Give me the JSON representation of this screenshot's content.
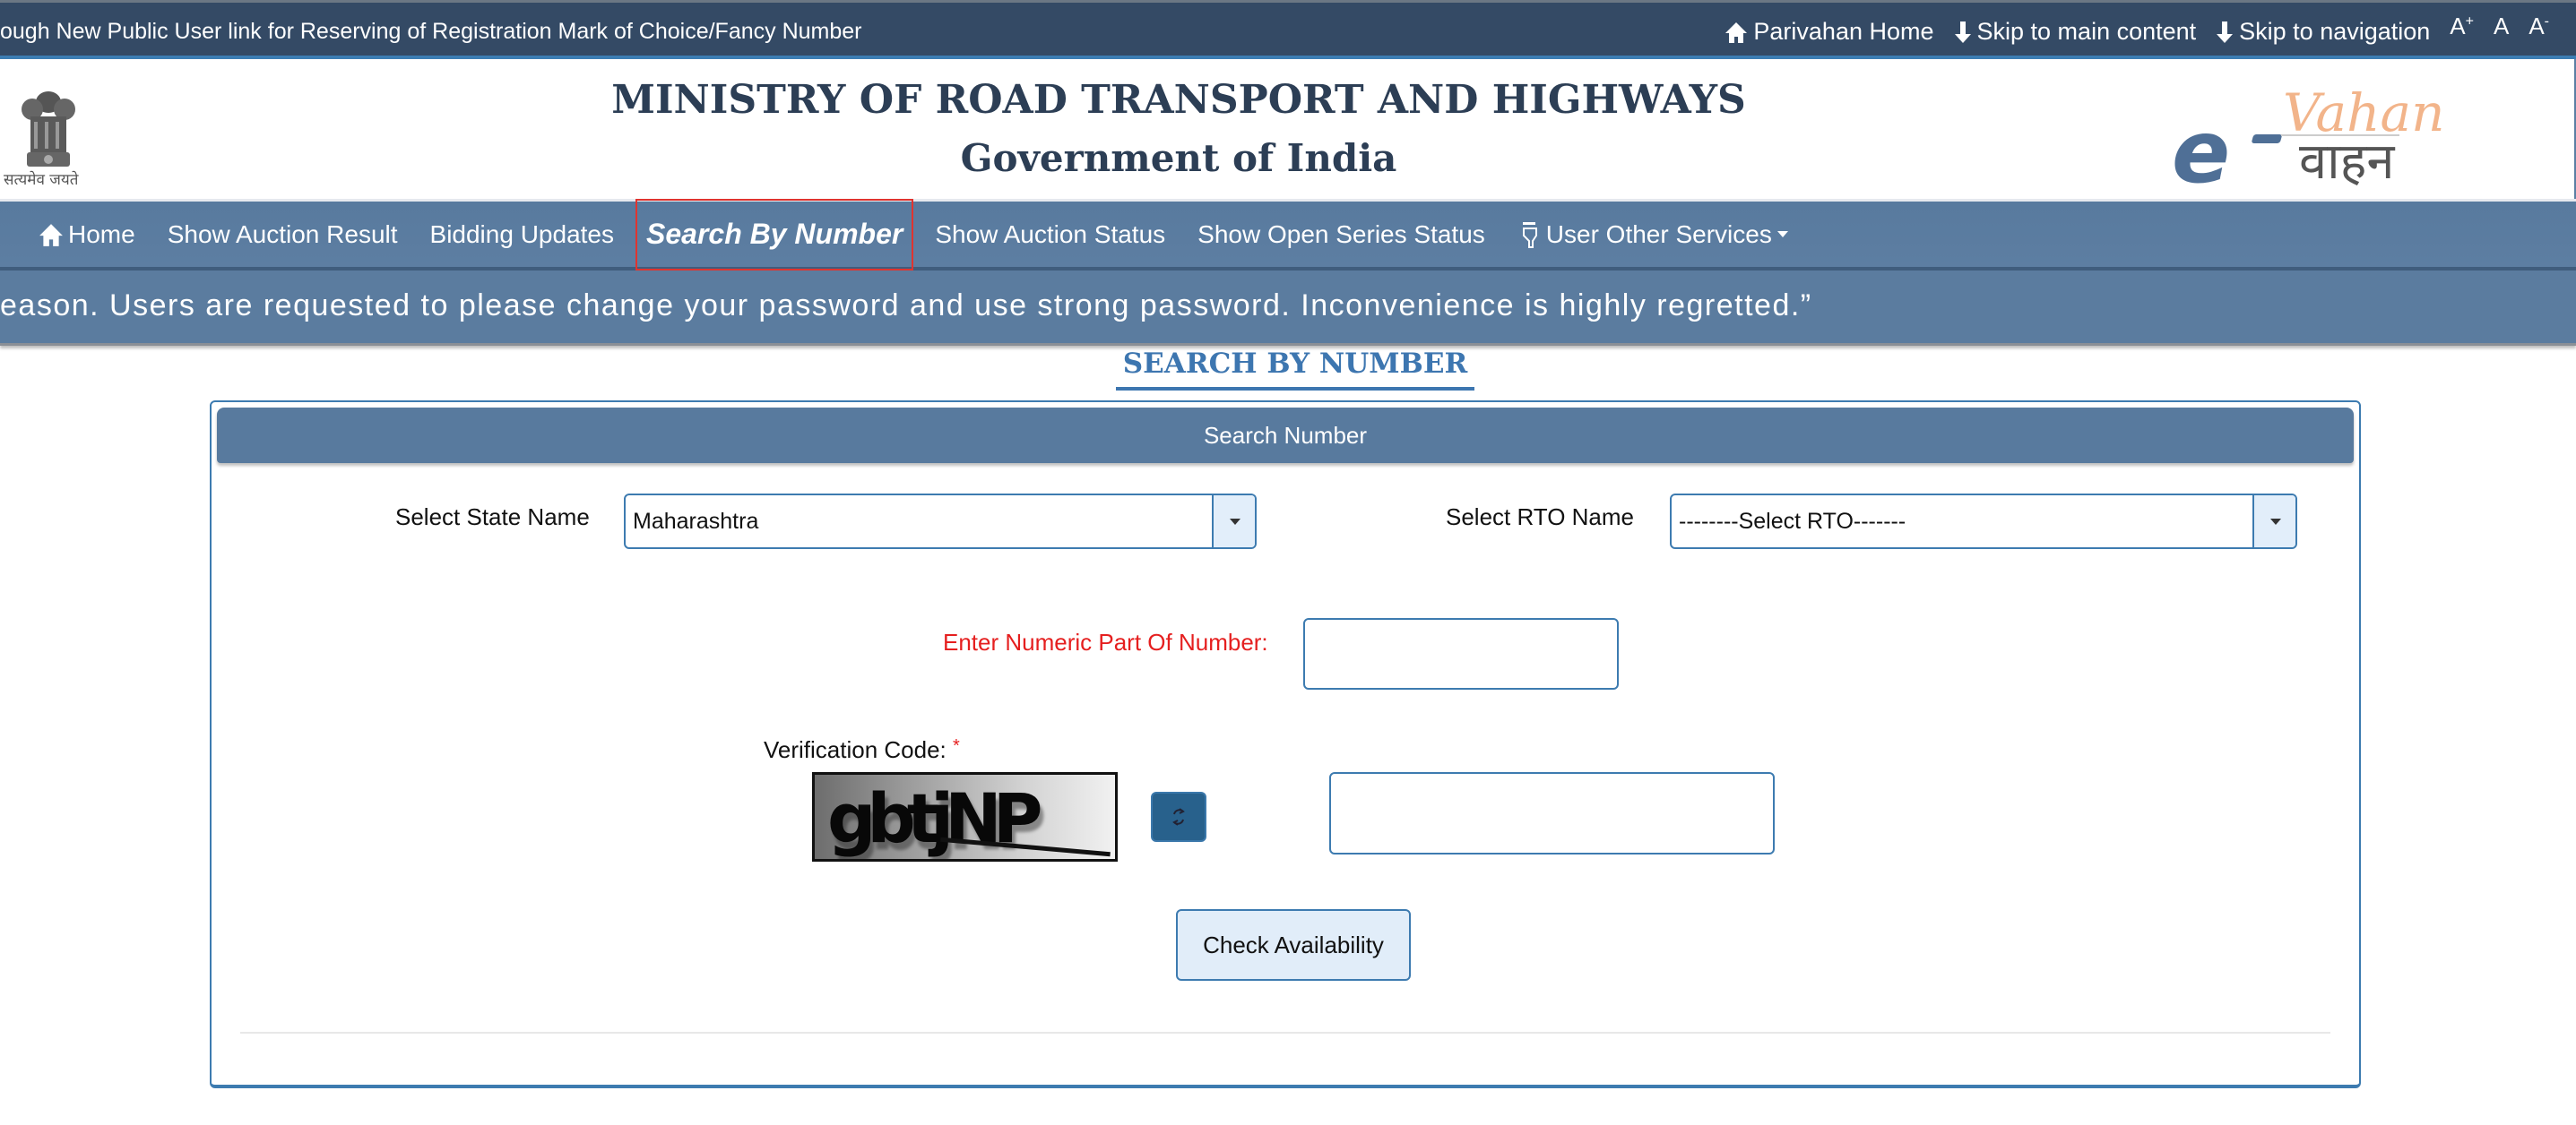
{
  "topbar": {
    "marquee": "ough New Public User link for Reserving of Registration Mark of Choice/Fancy Number",
    "links": {
      "parivahan_home": "Parivahan Home",
      "skip_main": "Skip to main content",
      "skip_nav": "Skip to navigation"
    },
    "font_controls": {
      "increase": "A",
      "increase_sup": "+",
      "normal": "A",
      "decrease": "A",
      "decrease_sup": "-"
    }
  },
  "header": {
    "title": "MINISTRY OF ROAD TRANSPORT AND HIGHWAYS",
    "subtitle": "Government of India",
    "emblem_motto": "सत्यमेव जयते",
    "logo": {
      "prefix": "e",
      "name": "Vahan",
      "hindi": "वाहन"
    }
  },
  "nav": {
    "items": [
      {
        "label": "Home",
        "icon": "home-icon"
      },
      {
        "label": "Show Auction Result"
      },
      {
        "label": "Bidding Updates"
      },
      {
        "label": "Search By Number",
        "active": true
      },
      {
        "label": "Show Auction Status"
      },
      {
        "label": "Show Open Series Status"
      },
      {
        "label": "User Other Services",
        "icon": "hand-pointer-icon",
        "dropdown": true
      }
    ]
  },
  "notice": {
    "text": "eason. Users are requested to please change your password and use strong password. Inconvenience is highly regretted.”"
  },
  "page": {
    "title": "SEARCH BY NUMBER"
  },
  "form": {
    "panel_title": "Search Number",
    "state_label": "Select State Name",
    "state_value": "Maharashtra",
    "rto_label": "Select RTO Name",
    "rto_value": "--------Select RTO-------",
    "numeric_label": "Enter Numeric Part Of Number:",
    "numeric_value": "",
    "verification_label": "Verification Code:",
    "required_mark": "*",
    "captcha_text": "gbtjNP",
    "captcha_input_value": "",
    "submit_label": "Check Availability"
  },
  "colors": {
    "topbar_bg": "#344a65",
    "nav_bg": "#587a9e",
    "accent": "#3d7bb0",
    "active_nav_border": "#e0342f",
    "required_red": "#e51f1f",
    "button_bg": "#e1edf9",
    "refresh_bg": "#28618c"
  }
}
